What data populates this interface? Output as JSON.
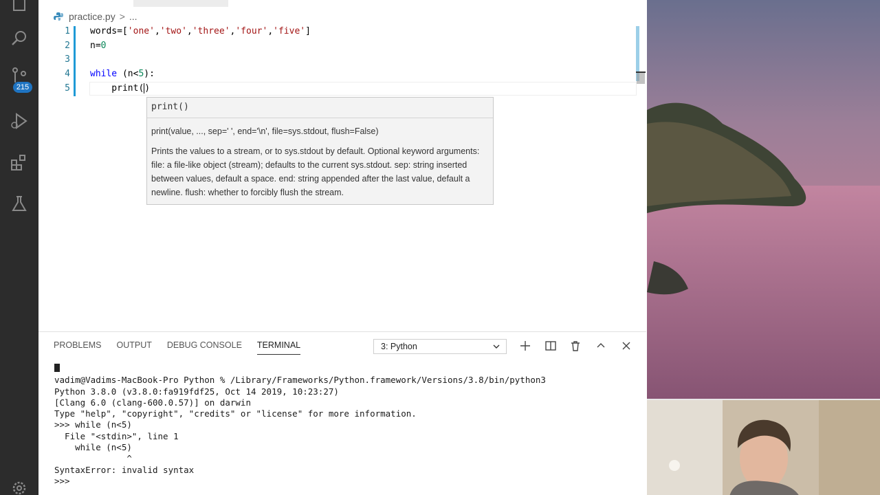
{
  "activity_bar": {
    "scm_badge": "215"
  },
  "editor": {
    "breadcrumb": {
      "file": "practice.py",
      "sep": ">",
      "more": "..."
    },
    "lines": [
      {
        "num": "1"
      },
      {
        "num": "2"
      },
      {
        "num": "3"
      },
      {
        "num": "4"
      },
      {
        "num": "5"
      }
    ],
    "code": {
      "l1_a": "words=[",
      "l1_s1": "'one'",
      "l1_s2": "'two'",
      "l1_s3": "'three'",
      "l1_s4": "'four'",
      "l1_s5": "'five'",
      "l1_end": "]",
      "comma": ",",
      "l2_a": "n=",
      "l2_num": "0",
      "l4_kw": "while",
      "l4_a": " (n<",
      "l4_num": "5",
      "l4_b": "):",
      "l5_a": "    print(",
      "l5_b": ")"
    },
    "hover": {
      "head": "print()",
      "signature": "print(value, ..., sep=' ', end='\\n', file=sys.stdout, flush=False)",
      "doc": "Prints the values to a stream, or to sys.stdout by default. Optional keyword arguments: file: a file-like object (stream); defaults to the current sys.stdout. sep: string inserted between values, default a space. end: string appended after the last value, default a newline. flush: whether to forcibly flush the stream."
    }
  },
  "panel": {
    "tabs": [
      "PROBLEMS",
      "OUTPUT",
      "DEBUG CONSOLE",
      "TERMINAL"
    ],
    "active_tab": "TERMINAL",
    "terminal_select": "3: Python",
    "terminal_lines": [
      "vadim@Vadims-MacBook-Pro Python % /Library/Frameworks/Python.framework/Versions/3.8/bin/python3",
      "Python 3.8.0 (v3.8.0:fa919fdf25, Oct 14 2019, 10:23:27)",
      "[Clang 6.0 (clang-600.0.57)] on darwin",
      "Type \"help\", \"copyright\", \"credits\" or \"license\" for more information.",
      ">>> while (n<5)",
      "  File \"<stdin>\", line 1",
      "    while (n<5)",
      "              ^",
      "SyntaxError: invalid syntax",
      ">>> "
    ]
  }
}
